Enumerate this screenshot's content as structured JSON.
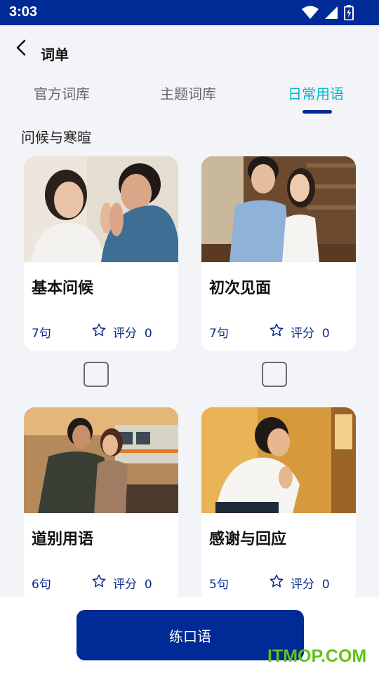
{
  "status_bar": {
    "time": "3:03"
  },
  "header": {
    "title": "词单"
  },
  "tabs": [
    {
      "label": "官方词库",
      "active": false
    },
    {
      "label": "主题词库",
      "active": false
    },
    {
      "label": "日常用语",
      "active": true
    }
  ],
  "section": {
    "title": "问候与寒暄"
  },
  "cards": [
    {
      "name": "基本问候",
      "count": "7句",
      "rating_label": "评分",
      "rating_value": "0"
    },
    {
      "name": "初次见面",
      "count": "7句",
      "rating_label": "评分",
      "rating_value": "0"
    },
    {
      "name": "道别用语",
      "count": "6句",
      "rating_label": "评分",
      "rating_value": "0"
    },
    {
      "name": "感谢与回应",
      "count": "5句",
      "rating_label": "评分",
      "rating_value": "0"
    }
  ],
  "action": {
    "practice_label": "练口语"
  },
  "watermark": "ITMOP.COM",
  "colors": {
    "primary": "#002a96",
    "active_tab": "#00b6c8",
    "text_blue": "#0a2a8a",
    "watermark": "#5fc318"
  }
}
